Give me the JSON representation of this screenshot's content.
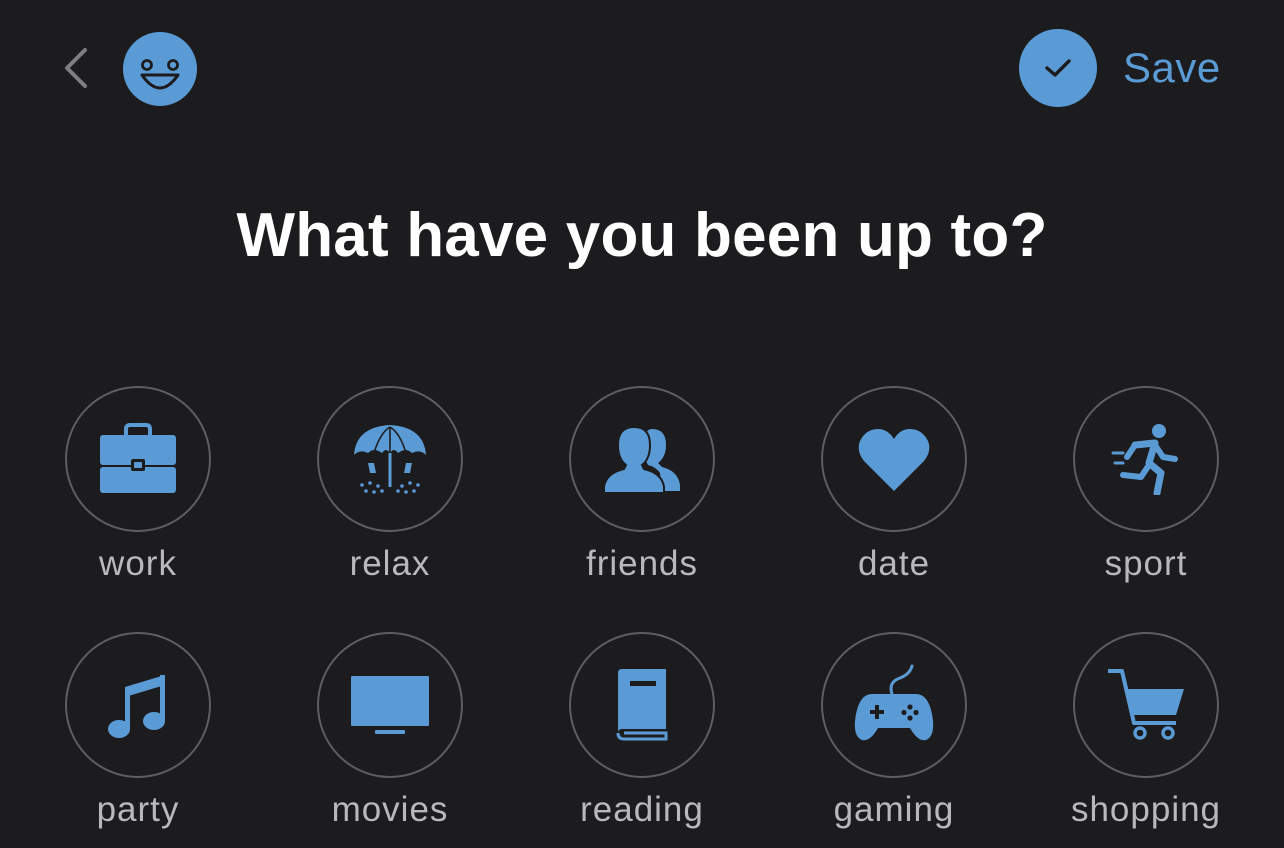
{
  "header": {
    "back_icon": "chevron-left-icon",
    "mood_icon": "smiley-face-icon",
    "save_icon": "checkmark-icon",
    "save_label": "Save"
  },
  "title": "What have you been up to?",
  "activities": [
    {
      "label": "work",
      "icon": "briefcase-icon"
    },
    {
      "label": "relax",
      "icon": "beach-umbrella-icon"
    },
    {
      "label": "friends",
      "icon": "people-icon"
    },
    {
      "label": "date",
      "icon": "heart-icon"
    },
    {
      "label": "sport",
      "icon": "running-person-icon"
    },
    {
      "label": "party",
      "icon": "music-note-icon"
    },
    {
      "label": "movies",
      "icon": "tv-screen-icon"
    },
    {
      "label": "reading",
      "icon": "book-icon"
    },
    {
      "label": "gaming",
      "icon": "gamepad-icon"
    },
    {
      "label": "shopping",
      "icon": "shopping-cart-icon"
    }
  ],
  "colors": {
    "background": "#1c1c1e",
    "accent": "#5b9bd5",
    "ring": "#5e5e62",
    "label": "#b9b9bc",
    "title": "#ffffff"
  }
}
